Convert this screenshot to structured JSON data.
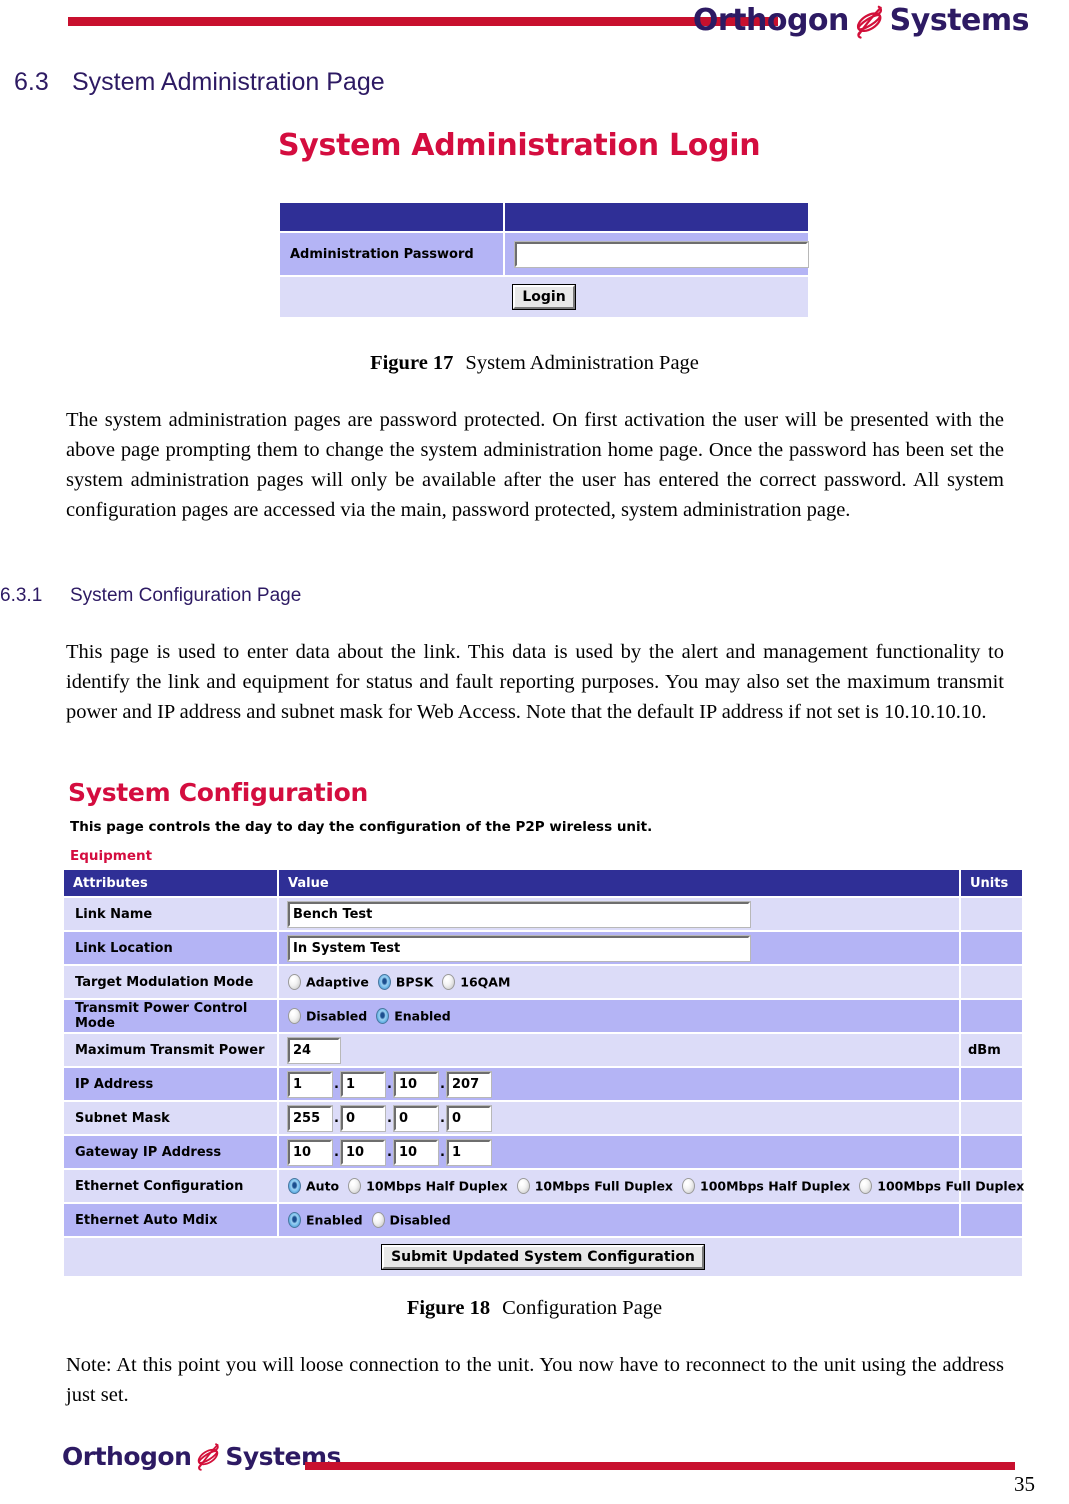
{
  "brand": {
    "name_part1": "Orthogon",
    "name_part2": "Systems",
    "logo_word_color": "#2d1a63",
    "logo_mark_color": "#d2103a",
    "rule_color": "#c8102e"
  },
  "headings": {
    "section_number": "6.3",
    "section_title": "System Administration Page",
    "subsection_number": "6.3.1",
    "subsection_title": "System Configuration Page",
    "heading_color": "#2d1a63"
  },
  "login_screenshot": {
    "title": "System Administration Login",
    "title_color": "#d40d3f",
    "header_row": {
      "left": "",
      "right": ""
    },
    "password_label": "Administration Password",
    "password_value": "",
    "password_placeholder": "",
    "login_button": "Login",
    "header_bg": "#2f2f96",
    "row_medium_bg": "#b4b4f5",
    "row_light_bg": "#dcdcf8"
  },
  "figure17": {
    "label": "Figure 17",
    "text": "System Administration Page"
  },
  "paragraph1": "The system administration pages are password protected.  On first activation the user will be presented with the above page prompting them to change the system administration home page. Once the password has been set the system administration pages will only be available after the user has entered the correct password. All system configuration pages are accessed via the main, password protected, system administration page.",
  "paragraph2": "This page is used to enter data about the link.  This data is used by the alert and management functionality to identify the link and equipment for status and fault reporting purposes. You may also set the maximum transmit power and IP address and subnet mask for Web Access. Note that the default IP address if not set is 10.10.10.10.",
  "config_screenshot": {
    "title": "System Configuration",
    "title_color": "#d40d3f",
    "intro": "This page controls the day to day the configuration of the P2P wireless unit.",
    "group_label": "Equipment",
    "columns": [
      "Attributes",
      "Value",
      "Units"
    ],
    "submit_button": "Submit Updated System Configuration",
    "rows": [
      {
        "attribute": "Link Name",
        "type": "text",
        "value": "Bench Test",
        "units": ""
      },
      {
        "attribute": "Link Location",
        "type": "text",
        "value": "In System Test",
        "units": ""
      },
      {
        "attribute": "Target Modulation Mode",
        "type": "radio",
        "options": [
          {
            "label": "Adaptive",
            "selected": false
          },
          {
            "label": "BPSK",
            "selected": true
          },
          {
            "label": "16QAM",
            "selected": false
          }
        ],
        "units": ""
      },
      {
        "attribute": "Transmit Power Control Mode",
        "type": "radio",
        "options": [
          {
            "label": "Disabled",
            "selected": false
          },
          {
            "label": "Enabled",
            "selected": true
          }
        ],
        "units": ""
      },
      {
        "attribute": "Maximum Transmit Power",
        "type": "number",
        "value": "24",
        "units": "dBm"
      },
      {
        "attribute": "IP Address",
        "type": "ip",
        "octets": [
          "1",
          "1",
          "10",
          "207"
        ],
        "units": ""
      },
      {
        "attribute": "Subnet Mask",
        "type": "ip",
        "octets": [
          "255",
          "0",
          "0",
          "0"
        ],
        "units": ""
      },
      {
        "attribute": "Gateway IP Address",
        "type": "ip",
        "octets": [
          "10",
          "10",
          "10",
          "1"
        ],
        "units": ""
      },
      {
        "attribute": "Ethernet Configuration",
        "type": "radio",
        "options": [
          {
            "label": "Auto",
            "selected": true
          },
          {
            "label": "10Mbps Half Duplex",
            "selected": false
          },
          {
            "label": "10Mbps Full Duplex",
            "selected": false
          },
          {
            "label": "100Mbps Half Duplex",
            "selected": false
          },
          {
            "label": "100Mbps Full Duplex",
            "selected": false
          }
        ],
        "units": ""
      },
      {
        "attribute": "Ethernet Auto Mdix",
        "type": "radio",
        "options": [
          {
            "label": "Enabled",
            "selected": true
          },
          {
            "label": "Disabled",
            "selected": false
          }
        ],
        "units": ""
      }
    ]
  },
  "figure18": {
    "label": "Figure 18",
    "text": "Configuration Page"
  },
  "paragraph3": "Note: At this point you will loose connection to the unit. You now have to reconnect to the unit using the address just set.",
  "footer": {
    "page_number": "35"
  }
}
